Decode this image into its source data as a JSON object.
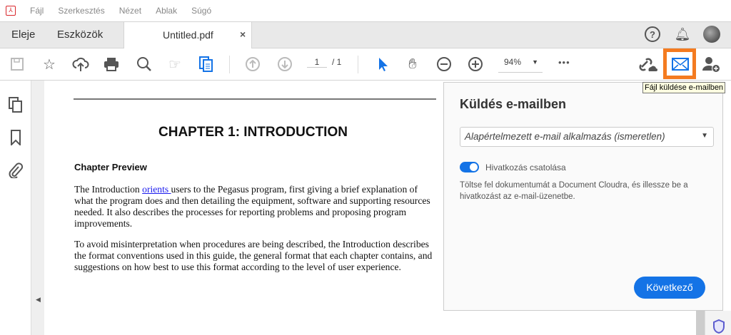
{
  "menu": {
    "items": [
      "Fájl",
      "Szerkesztés",
      "Nézet",
      "Ablak",
      "Súgó"
    ]
  },
  "tabs": {
    "home": "Eleje",
    "tools": "Eszközök",
    "document": "Untitled.pdf",
    "close": "×"
  },
  "toolbar": {
    "page_current": "1",
    "page_total": "/ 1",
    "zoom": "94%",
    "more": "•••"
  },
  "tooltip": "Fájl küldése e-mailben",
  "document": {
    "chapter_title": "CHAPTER 1:  INTRODUCTION",
    "section": "Chapter Preview",
    "p1_before": "The Introduction ",
    "p1_link": "orients ",
    "p1_after": "users to the Pegasus program, first giving a brief explanation of what the program does and then detailing the equipment, software and supporting resources needed.  It also describes the processes for reporting problems and proposing program improvements.",
    "p2": "To avoid misinterpretation when procedures are being described, the Introduction describes the format conventions used in this guide, the general format that each chapter contains, and suggestions on how best to use this format according to the level of user experience."
  },
  "panel": {
    "title": "Küldés e-mailben",
    "email_app": "Alapértelmezett e-mail alkalmazás (ismeretlen)",
    "toggle_label": "Hivatkozás csatolása",
    "toggle_on": true,
    "description": "Töltse fel dokumentumát a Document Cloudra, és illessze be a hivatkozást az e-mail-üzenetbe.",
    "next_button": "Következő"
  },
  "colors": {
    "accent": "#1473e6",
    "highlight": "#f47b20",
    "brand": "#d9262b"
  }
}
